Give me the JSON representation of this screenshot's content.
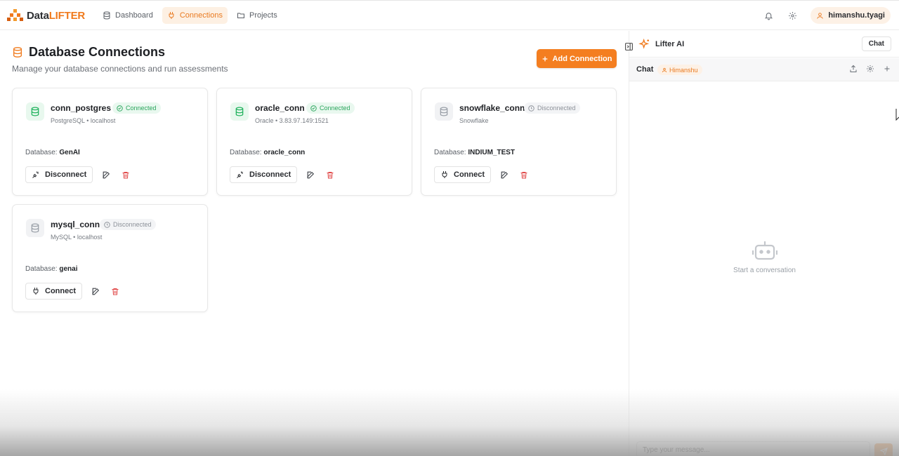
{
  "brand": {
    "name_part1": "Data",
    "name_part2": "LIFTER"
  },
  "nav": [
    {
      "label": "Dashboard",
      "icon": "database-icon",
      "active": false
    },
    {
      "label": "Connections",
      "icon": "plug-icon",
      "active": true
    },
    {
      "label": "Projects",
      "icon": "folder-icon",
      "active": false
    }
  ],
  "user": {
    "name": "himanshu.tyagi"
  },
  "page": {
    "title": "Database Connections",
    "subtitle": "Manage your database connections and run assessments",
    "add_label": "Add Connection"
  },
  "db_label": "Database:",
  "edit_icon": "edit-icon",
  "delete_icon": "trash-icon",
  "connections": [
    {
      "name": "conn_postgres",
      "status": "Connected",
      "meta": "PostgreSQL • localhost",
      "database": "GenAI",
      "action": "Disconnect"
    },
    {
      "name": "oracle_conn",
      "status": "Connected",
      "meta": "Oracle • 3.83.97.149:1521",
      "database": "oracle_conn",
      "action": "Disconnect"
    },
    {
      "name": "snowflake_conn",
      "status": "Disconnected",
      "meta": "Snowflake",
      "database": "INDIUM_TEST",
      "action": "Connect"
    },
    {
      "name": "mysql_conn",
      "status": "Disconnected",
      "meta": "MySQL • localhost",
      "database": "genai",
      "action": "Connect"
    }
  ],
  "assistant": {
    "title": "Lifter AI",
    "chat_button": "Chat",
    "chat_label": "Chat",
    "user_tag": "Himanshu",
    "empty_text": "Start a conversation",
    "input_placeholder": "Type your message..."
  },
  "colors": {
    "accent": "#f47e20",
    "connected": "#22b35e",
    "danger": "#e14b4b"
  }
}
